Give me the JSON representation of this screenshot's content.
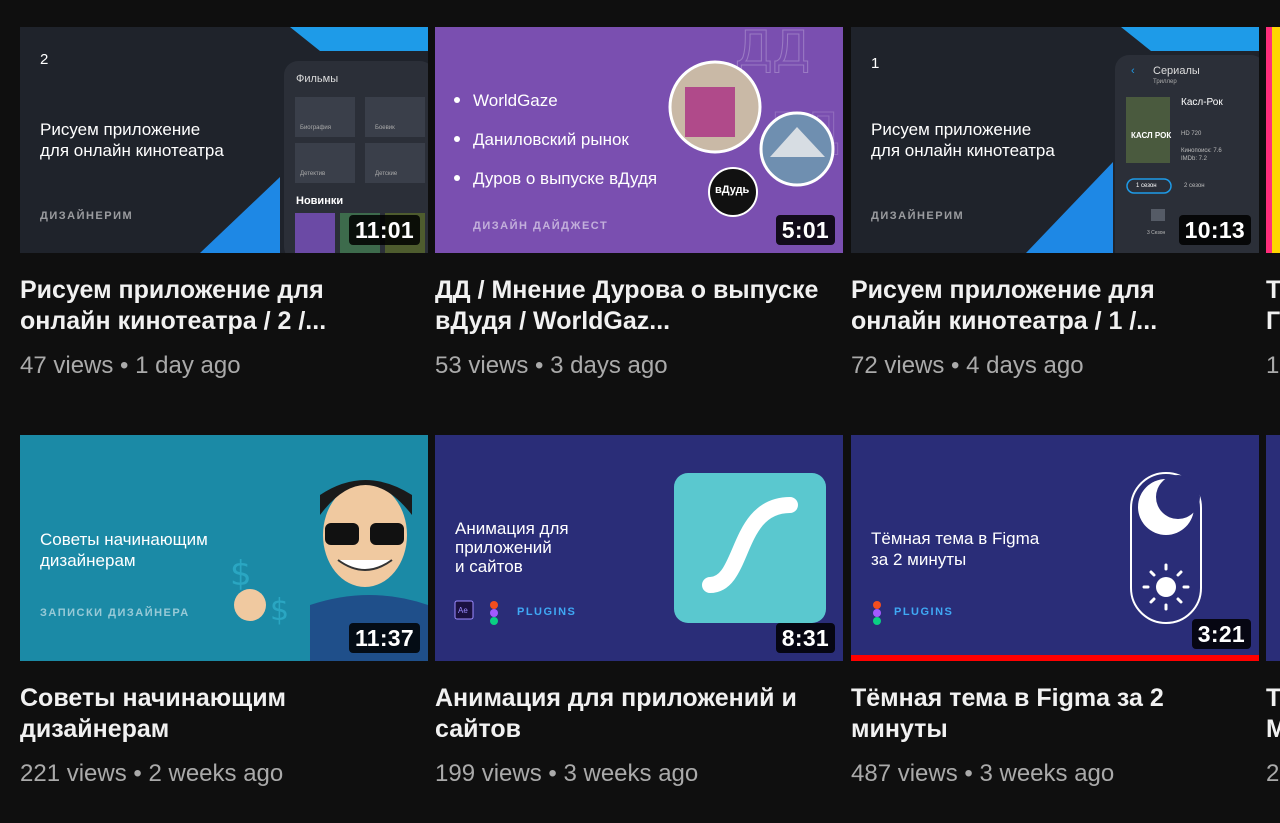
{
  "videos": [
    {
      "title": "Рисуем приложение для онлайн кинотеатра / 2 /...",
      "views": "47 views",
      "age": "1 day ago",
      "duration": "11:01",
      "thumb": {
        "number": "2",
        "heading": "Рисуем приложение\nдля онлайн кинотеатра",
        "kicker": "ДИЗАЙНЕРИМ",
        "panel_title": "Фильмы",
        "panel_items": [
          "Биография",
          "Боевик",
          "Детектив",
          "Детские"
        ],
        "panel_section": "Новинки"
      }
    },
    {
      "title": "ДД / Мнение Дурова о выпуске вДудя / WorldGaz...",
      "views": "53 views",
      "age": "3 days ago",
      "duration": "5:01",
      "thumb": {
        "bullets": [
          "WorldGaze",
          "Даниловский рынок",
          "Дуров о выпуске вДудя"
        ],
        "kicker": "ДИЗАЙН ДАЙДЖЕСТ",
        "badge": "вДудь"
      }
    },
    {
      "title": "Рисуем приложение для онлайн кинотеатра / 1 /...",
      "views": "72 views",
      "age": "4 days ago",
      "duration": "10:13",
      "thumb": {
        "number": "1",
        "heading": "Рисуем приложение\nдля онлайн кинотеатра",
        "kicker": "ДИЗАЙНЕРИМ",
        "panel_title": "Сериалы",
        "panel_sub": "Триллер",
        "show": "Касл-Рок",
        "show_meta": [
          "HD 720",
          "Кинопоиск: 7.6",
          "IMDb: 7.2"
        ],
        "seasons": [
          "1 сезон",
          "2 сезон"
        ],
        "poster_text": "КАСЛ РОК",
        "season_count": "3 Сезон"
      }
    },
    {
      "title": "Советы начинающим дизайнерам",
      "views": "221 views",
      "age": "2 weeks ago",
      "duration": "11:37",
      "thumb": {
        "heading": "Советы начинающим\nдизайнерам",
        "kicker": "ЗАПИСКИ ДИЗАЙНЕРА"
      }
    },
    {
      "title": "Анимация для приложений и сайтов",
      "views": "199 views",
      "age": "3 weeks ago",
      "duration": "8:31",
      "thumb": {
        "heading": "Анимация для\nприложений\nи сайтов",
        "kicker": "PLUGINS",
        "ae": "Ae"
      }
    },
    {
      "title": "Тёмная тема в Figma за 2 минуты",
      "views": "487 views",
      "age": "3 weeks ago",
      "duration": "3:21",
      "progress": 1.0,
      "thumb": {
        "heading": "Тёмная тема в Figma\nза 2 минуты",
        "kicker": "PLUGINS"
      }
    }
  ],
  "partial_cards": [
    {
      "title_fragment": "Т\nГ",
      "meta_fragment": "1"
    },
    {
      "title_fragment": "Т\nМ",
      "meta_fragment": "2"
    }
  ],
  "colors": {
    "background": "#0f0f0f",
    "meta_text": "#aaaaaa",
    "progress": "#ff0000"
  }
}
